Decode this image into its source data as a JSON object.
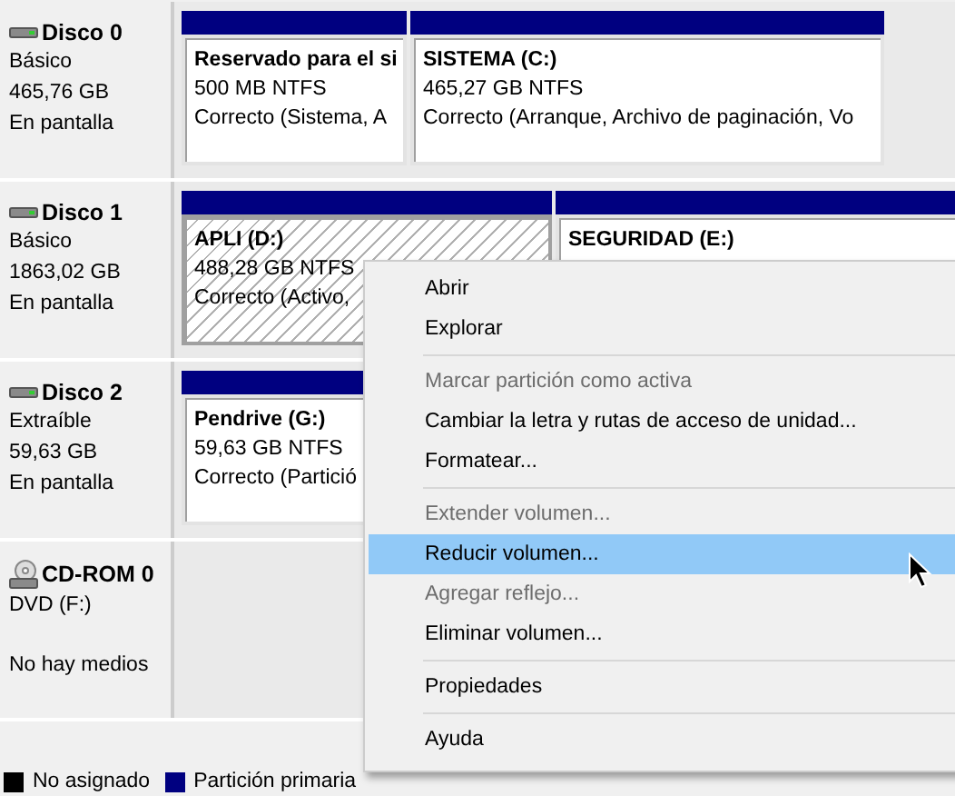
{
  "disks": [
    {
      "name": "Disco 0",
      "kind": "hdd",
      "type": "Básico",
      "size": "465,76 GB",
      "status": "En pantalla",
      "partitions": [
        {
          "name": "Reservado para el si",
          "size_fs": "500 MB NTFS",
          "status": "Correcto (Sistema, A",
          "selected": false
        },
        {
          "name": "SISTEMA  (C:)",
          "size_fs": "465,27 GB NTFS",
          "status": "Correcto (Arranque, Archivo de paginación, Vo",
          "selected": false
        }
      ]
    },
    {
      "name": "Disco 1",
      "kind": "hdd",
      "type": "Básico",
      "size": "1863,02 GB",
      "status": "En pantalla",
      "partitions": [
        {
          "name": "APLI  (D:)",
          "size_fs": "488,28 GB NTFS",
          "status": "Correcto (Activo,",
          "selected": true
        },
        {
          "name": "SEGURIDAD  (E:)",
          "selected": false
        }
      ]
    },
    {
      "name": "Disco 2",
      "kind": "hdd",
      "type": "Extraíble",
      "size": "59,63 GB",
      "status": "En pantalla",
      "partitions": [
        {
          "name": "Pendrive  (G:)",
          "size_fs": "59,63 GB NTFS",
          "status": "Correcto (Partició",
          "selected": false
        }
      ]
    },
    {
      "name": "CD-ROM 0",
      "kind": "cdrom",
      "type": "DVD (F:)",
      "status": "No hay medios"
    }
  ],
  "legend": [
    {
      "label": "No asignado",
      "color": "#000000"
    },
    {
      "label": "Partición primaria",
      "color": "#000080"
    }
  ],
  "context_menu": [
    {
      "kind": "item",
      "label": "Abrir",
      "disabled": false,
      "selected": false
    },
    {
      "kind": "item",
      "label": "Explorar",
      "disabled": false,
      "selected": false
    },
    {
      "kind": "separator"
    },
    {
      "kind": "item",
      "label": "Marcar partición como activa",
      "disabled": true,
      "selected": false
    },
    {
      "kind": "item",
      "label": "Cambiar la letra y rutas de acceso de unidad...",
      "disabled": false,
      "selected": false
    },
    {
      "kind": "item",
      "label": "Formatear...",
      "disabled": false,
      "selected": false
    },
    {
      "kind": "separator"
    },
    {
      "kind": "item",
      "label": "Extender volumen...",
      "disabled": true,
      "selected": false
    },
    {
      "kind": "item",
      "label": "Reducir volumen...",
      "disabled": false,
      "selected": true
    },
    {
      "kind": "item",
      "label": "Agregar reflejo...",
      "disabled": true,
      "selected": false
    },
    {
      "kind": "item",
      "label": "Eliminar volumen...",
      "disabled": false,
      "selected": false
    },
    {
      "kind": "separator"
    },
    {
      "kind": "item",
      "label": "Propiedades",
      "disabled": false,
      "selected": false
    },
    {
      "kind": "separator"
    },
    {
      "kind": "item",
      "label": "Ayuda",
      "disabled": false,
      "selected": false
    }
  ]
}
